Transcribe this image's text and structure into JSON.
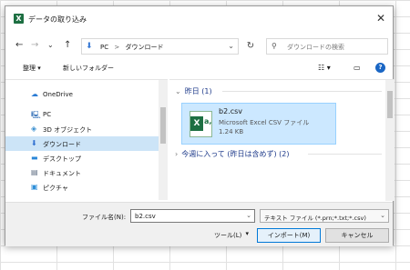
{
  "window": {
    "title": "データの取り込み",
    "app_icon": "excel-icon"
  },
  "navigation": {
    "back": "←",
    "forward": "→",
    "recent": "⌄",
    "up": "↑",
    "address": {
      "root": "PC",
      "separator": ">",
      "folder": "ダウンロード"
    },
    "search_placeholder": "ダウンロードの検索"
  },
  "toolbar": {
    "organize_label": "整理 ▾",
    "new_folder_label": "新しいフォルダー",
    "help": "?"
  },
  "sidebar": {
    "items": [
      {
        "label": "OneDrive",
        "icon": "cloud-icon"
      },
      {
        "label": "PC",
        "icon": "computer-icon"
      },
      {
        "label": "3D オブジェクト",
        "icon": "cube-icon"
      },
      {
        "label": "ダウンロード",
        "icon": "download-icon",
        "selected": true
      },
      {
        "label": "デスクトップ",
        "icon": "desktop-icon"
      },
      {
        "label": "ドキュメント",
        "icon": "document-icon"
      },
      {
        "label": "ピクチャ",
        "icon": "picture-icon"
      }
    ]
  },
  "content": {
    "groups": [
      {
        "title": "昨日 (1)"
      },
      {
        "title": "今週に入って (昨日は含めず) (2)"
      }
    ],
    "file": {
      "name": "b2.csv",
      "type": "Microsoft Excel CSV ファイル",
      "size": "1.24 KB"
    }
  },
  "footer": {
    "filename_label": "ファイル名(N):",
    "filename_value": "b2.csv",
    "filetype_value": "テキスト ファイル (*.prn;*.txt;*.csv)",
    "tools_label": "ツール(L)",
    "import_label": "インポート(M)",
    "cancel_label": "キャンセル"
  },
  "colors": {
    "selection": "#cce8ff",
    "accent": "#0078d7",
    "excel_green": "#1d6f42"
  }
}
